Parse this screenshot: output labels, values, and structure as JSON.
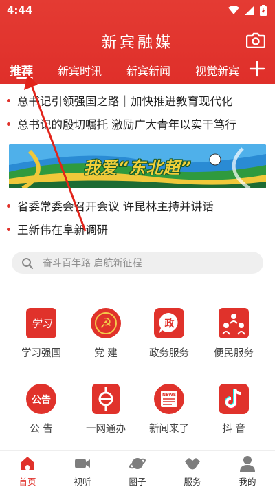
{
  "status": {
    "time": "4:44"
  },
  "header": {
    "title": "新宾融媒",
    "tabs": [
      {
        "label": "推荐"
      },
      {
        "label": "新宾时讯"
      },
      {
        "label": "新宾新闻"
      },
      {
        "label": "视觉新宾"
      }
    ]
  },
  "headlines": [
    {
      "text": "总书记引领强国之路｜加快推进教育现代化"
    },
    {
      "text": "总书记的殷切嘱托 激励广大青年以实干笃行"
    },
    {
      "text": "省委常委会召开会议 许昆林主持并讲话"
    },
    {
      "text": "王新伟在阜新调研"
    }
  ],
  "banner": {
    "text": "我爱“东北超”"
  },
  "search": {
    "placeholder": "奋斗百年路 启航新征程"
  },
  "services": [
    {
      "label": "学习强国",
      "icon_text": "学习"
    },
    {
      "label": "党 建",
      "icon_text": "☭"
    },
    {
      "label": "政务服务",
      "icon_text": "政"
    },
    {
      "label": "便民服务",
      "icon_text": ""
    },
    {
      "label": "公 告",
      "icon_text": "公告"
    },
    {
      "label": "一网通办",
      "icon_text": ""
    },
    {
      "label": "新闻来了",
      "icon_text": "NEWS"
    },
    {
      "label": "抖 音",
      "icon_text": "♪"
    }
  ],
  "bottom_nav": [
    {
      "label": "首页"
    },
    {
      "label": "视听"
    },
    {
      "label": "圈子"
    },
    {
      "label": "服务"
    },
    {
      "label": "我的"
    }
  ],
  "colors": {
    "brand_red": "#e0322b",
    "nav_gray": "#7d7d7d"
  }
}
